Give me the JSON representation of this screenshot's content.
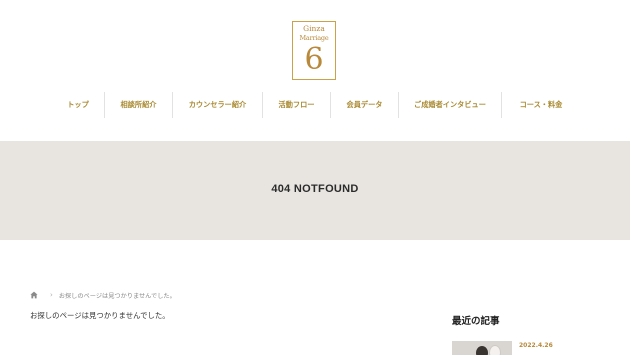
{
  "logo": {
    "line1": "Ginza",
    "line2": "Marriage",
    "mark": "6"
  },
  "nav": {
    "items": [
      {
        "label": "トップ"
      },
      {
        "label": "相談所紹介"
      },
      {
        "label": "カウンセラー紹介"
      },
      {
        "label": "活動フロー"
      },
      {
        "label": "会員データ"
      },
      {
        "label": "ご成婚者インタビュー"
      },
      {
        "label": "コース・料金"
      }
    ]
  },
  "hero": {
    "title": "404 NOTFOUND"
  },
  "breadcrumb": {
    "icon": "home-icon",
    "current": "お探しのページは見つかりませんでした。"
  },
  "main": {
    "message": "お探しのページは見つかりませんでした。"
  },
  "sidebar": {
    "title": "最近の記事",
    "posts": [
      {
        "date": "2022.4.26"
      }
    ]
  },
  "colors": {
    "accent": "#a98a32",
    "hero_bg": "#e8e5e0",
    "text": "#333333"
  }
}
